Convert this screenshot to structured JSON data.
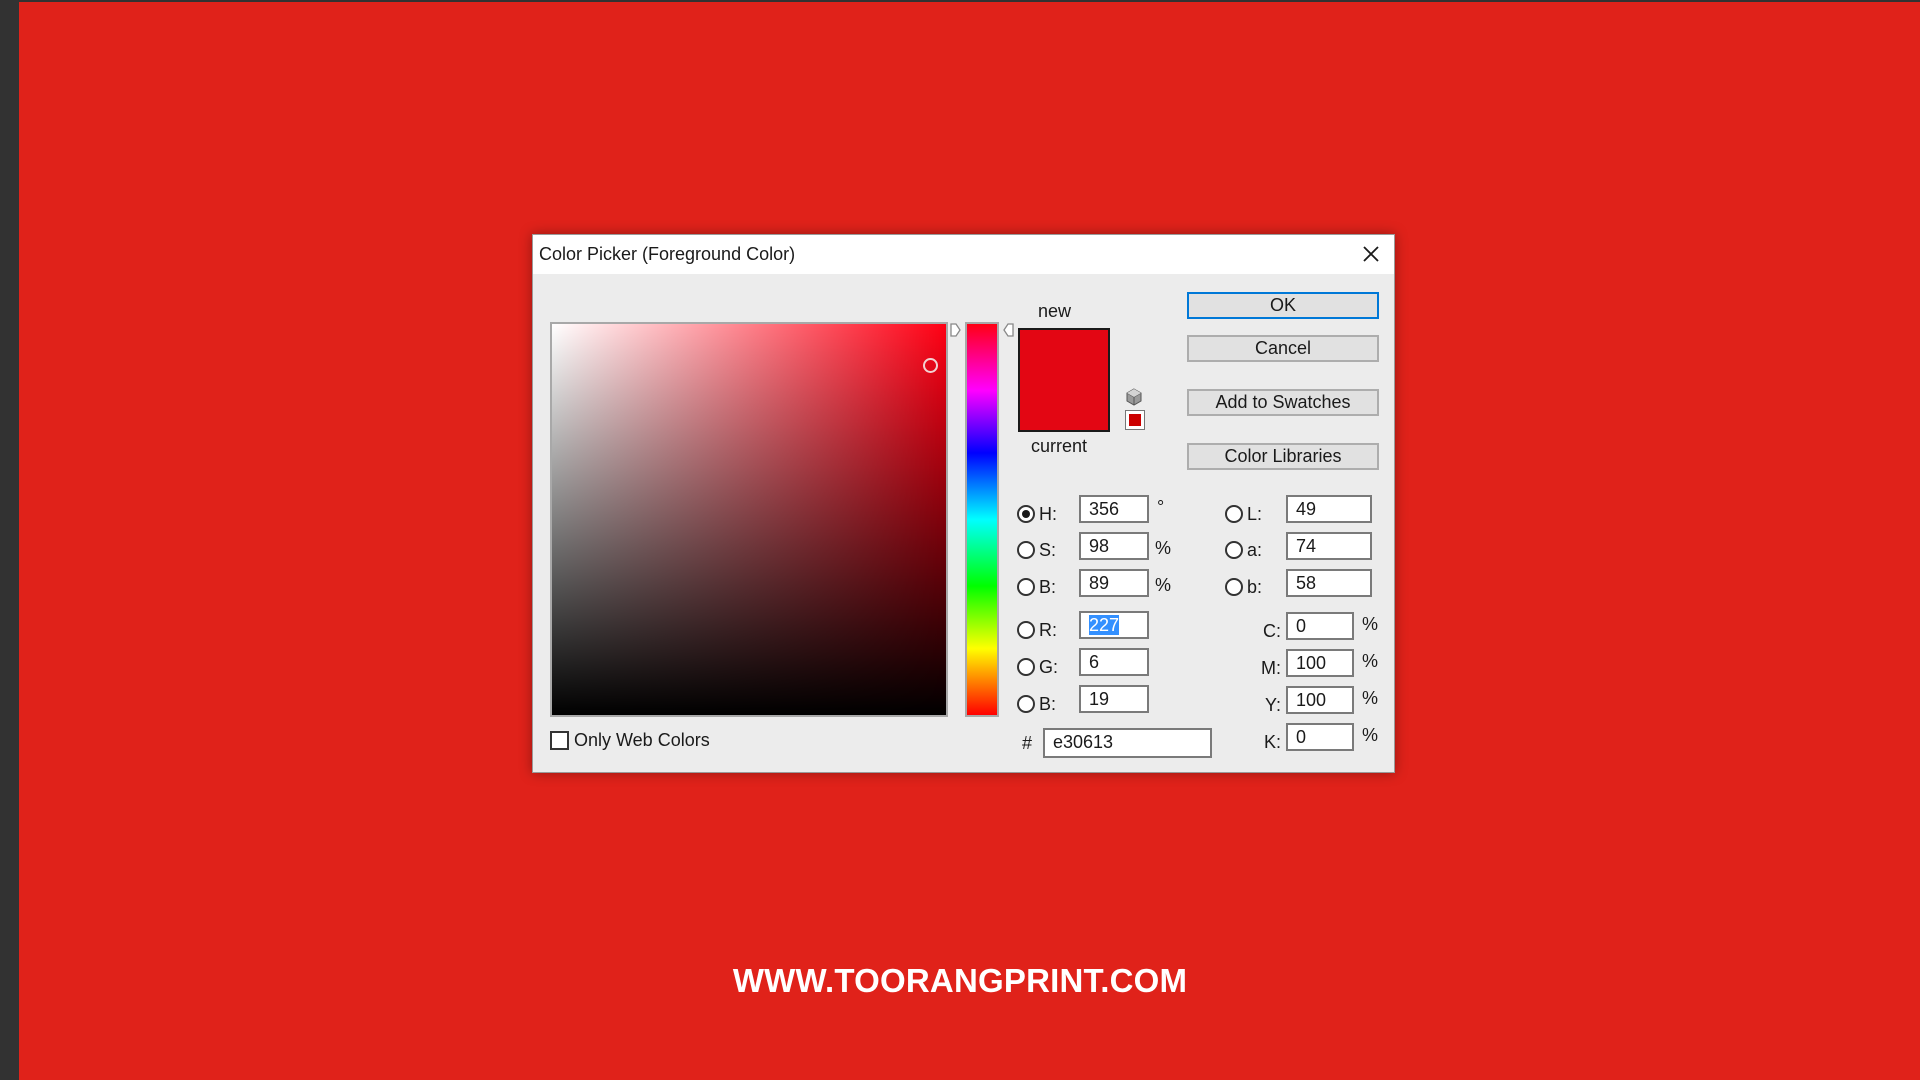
{
  "watermark": "WWW.TOORANGPRINT.COM",
  "dialog": {
    "title": "Color Picker (Foreground Color)",
    "close_icon": "close-icon",
    "new_label": "new",
    "current_label": "current",
    "new_color": "#e30613",
    "current_color": "#cc0000",
    "buttons": {
      "ok": "OK",
      "cancel": "Cancel",
      "add_to_swatches": "Add to Swatches",
      "color_libraries": "Color Libraries"
    },
    "only_web_colors": {
      "label": "Only Web Colors",
      "checked": false
    },
    "hsb": [
      {
        "label": "H:",
        "value": "356",
        "unit": "°",
        "selected": true
      },
      {
        "label": "S:",
        "value": "98",
        "unit": "%",
        "selected": false
      },
      {
        "label": "B:",
        "value": "89",
        "unit": "%",
        "selected": false
      }
    ],
    "rgb": [
      {
        "label": "R:",
        "value": "227",
        "selected": false
      },
      {
        "label": "G:",
        "value": "6",
        "selected": false
      },
      {
        "label": "B:",
        "value": "19",
        "selected": false
      }
    ],
    "lab": [
      {
        "label": "L:",
        "value": "49"
      },
      {
        "label": "a:",
        "value": "74"
      },
      {
        "label": "b:",
        "value": "58"
      }
    ],
    "cmyk": [
      {
        "label": "C:",
        "value": "0",
        "unit": "%"
      },
      {
        "label": "M:",
        "value": "100",
        "unit": "%"
      },
      {
        "label": "Y:",
        "value": "100",
        "unit": "%"
      },
      {
        "label": "K:",
        "value": "0",
        "unit": "%"
      }
    ],
    "hex": {
      "prefix": "#",
      "value": "e30613"
    }
  }
}
